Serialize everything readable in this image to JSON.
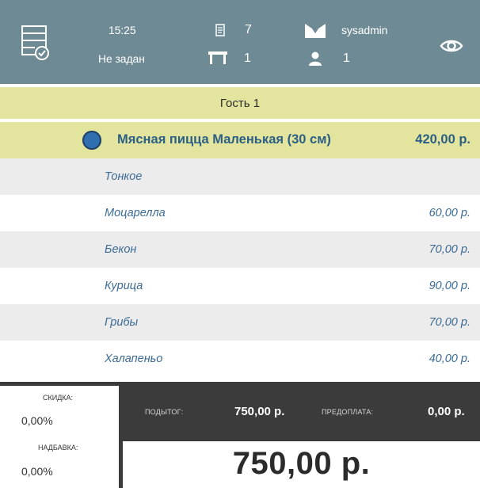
{
  "header": {
    "time": "15:25",
    "order_count": "7",
    "user": "sysadmin",
    "status": "Не задан",
    "table_count": "1",
    "guest_count": "1",
    "icons": {
      "order": "order-list-check-icon",
      "receipt": "receipt-icon",
      "waiter": "waiter-badge-icon",
      "table": "table-icon",
      "person": "person-icon",
      "eye": "eye-icon"
    },
    "bg_color": "#6e8a94"
  },
  "guest": {
    "label": "Гость 1",
    "bg_color": "#e3e49d"
  },
  "item": {
    "name": "Мясная пицца Маленькая (30 см)",
    "price": "420,00 р.",
    "selected": true,
    "radio_color": "#2f6fb0"
  },
  "modifiers": [
    {
      "name": "Тонкое",
      "price": ""
    },
    {
      "name": "Моцарелла",
      "price": "60,00 р."
    },
    {
      "name": "Бекон",
      "price": "70,00 р."
    },
    {
      "name": "Курица",
      "price": "90,00 р."
    },
    {
      "name": "Грибы",
      "price": "70,00 р."
    },
    {
      "name": "Халапеньо",
      "price": "40,00 р."
    }
  ],
  "footer": {
    "discount_label": "СКИДКА:",
    "discount_value": "0,00%",
    "markup_label": "НАДБАВКА:",
    "markup_value": "0,00%",
    "subtotal_label": "ПОДЫТОГ:",
    "subtotal_value": "750,00 р.",
    "prepay_label": "ПРЕДОПЛАТА:",
    "prepay_value": "0,00 р.",
    "total": "750,00 р."
  }
}
